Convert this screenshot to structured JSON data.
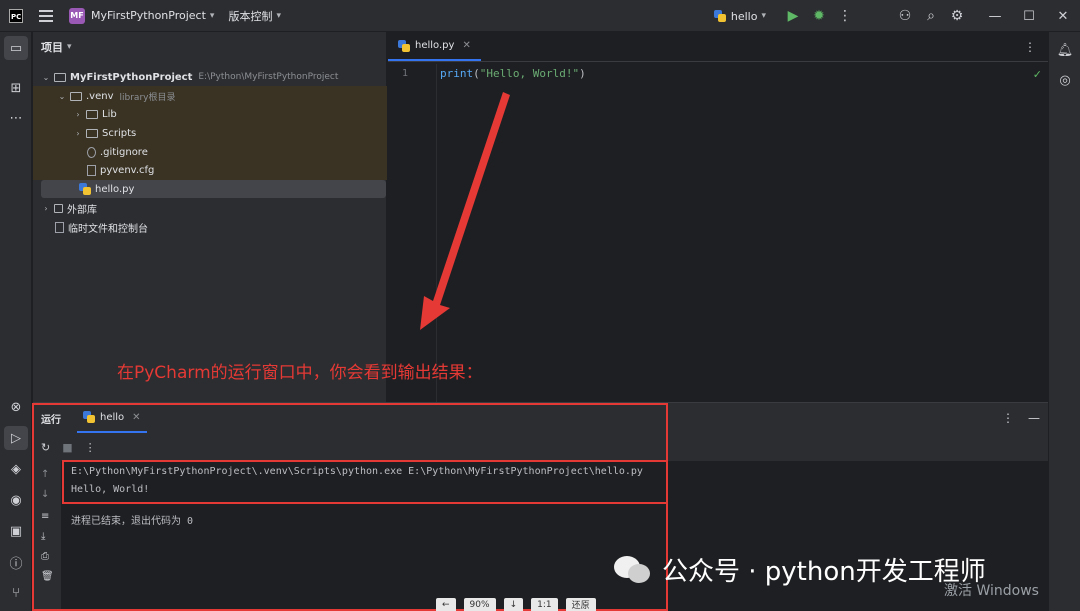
{
  "titlebar": {
    "project_badge": "MF",
    "project_name": "MyFirstPythonProject",
    "vcs_label": "版本控制",
    "run_config": "hello"
  },
  "project_panel": {
    "title": "项目",
    "root": {
      "name": "MyFirstPythonProject",
      "path": "E:\\Python\\MyFirstPythonProject"
    },
    "venv": {
      "name": ".venv",
      "hint": "library根目录"
    },
    "items": [
      {
        "label": "Lib"
      },
      {
        "label": "Scripts"
      },
      {
        "label": ".gitignore"
      },
      {
        "label": "pyvenv.cfg"
      },
      {
        "label": "hello.py"
      },
      {
        "label": "外部库"
      },
      {
        "label": "临时文件和控制台"
      }
    ]
  },
  "editor": {
    "tab_label": "hello.py",
    "line_number": "1",
    "code_fn": "print",
    "code_open": "(",
    "code_str": "\"Hello, World!\"",
    "code_close": ")"
  },
  "annotation": "在PyCharm的运行窗口中，你会看到输出结果：",
  "run_panel": {
    "title": "运行",
    "tab_label": "hello",
    "command": "E:\\Python\\MyFirstPythonProject\\.venv\\Scripts\\python.exe E:\\Python\\MyFirstPythonProject\\hello.py",
    "output": "Hello, World!",
    "exit_message": "进程已结束，退出代码为 0"
  },
  "overlay": {
    "watermark": "公众号 · python开发工程师",
    "activate": "激活 Windows",
    "zoom_buttons": [
      "←",
      "90%",
      "↓",
      "1:1",
      "还原"
    ]
  },
  "colors": {
    "accent": "#3574f0",
    "annotation_red": "#e53935",
    "run_green": "#5fb865",
    "venv_highlight": "#3a3324"
  }
}
